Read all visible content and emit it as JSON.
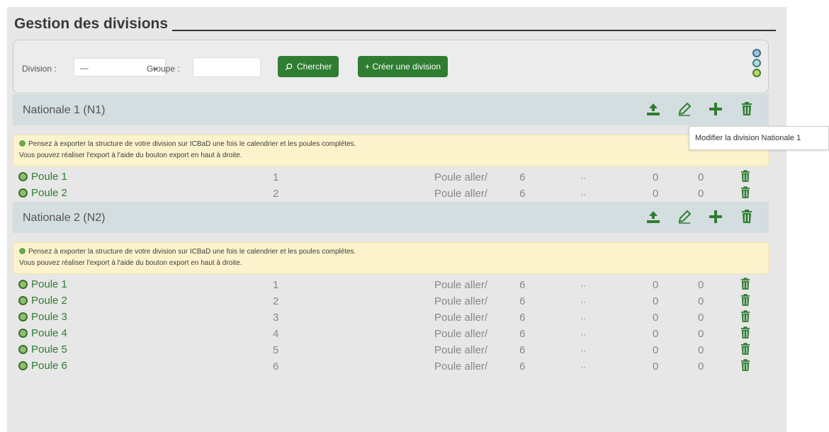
{
  "page": {
    "title": "Gestion des divisions"
  },
  "search": {
    "division_label": "Division :",
    "division_value": "---",
    "groupe_label": "Groupe :",
    "groupe_value": "",
    "search_button": "Chercher",
    "create_button": "+ Créer une division"
  },
  "colors": {
    "accent_green": "#2f7d32",
    "header_bg": "#d4dddf",
    "warning_bg": "#fcf3cd"
  },
  "tooltip": "Modifier la division Nationale 1",
  "warning": {
    "line1": "Pensez à exporter la structure de votre division sur ICBaD une fois le calendrier et les poules complétes.",
    "line2": "Vous pouvez réaliser l'export à l'aide du bouton export en haut à droite."
  },
  "divisions": [
    {
      "name": "Nationale 1 (N1)",
      "poules": [
        {
          "name": "Poule 1",
          "num": "1",
          "type": "Poule aller/",
          "count": "6",
          "dots": ",,",
          "z1": "0",
          "z2": "0"
        },
        {
          "name": "Poule 2",
          "num": "2",
          "type": "Poule aller/",
          "count": "6",
          "dots": ",,",
          "z1": "0",
          "z2": "0"
        }
      ]
    },
    {
      "name": "Nationale 2 (N2)",
      "poules": [
        {
          "name": "Poule 1",
          "num": "1",
          "type": "Poule aller/",
          "count": "6",
          "dots": ",,",
          "z1": "0",
          "z2": "0"
        },
        {
          "name": "Poule 2",
          "num": "2",
          "type": "Poule aller/",
          "count": "6",
          "dots": ",,",
          "z1": "0",
          "z2": "0"
        },
        {
          "name": "Poule 3",
          "num": "3",
          "type": "Poule aller/",
          "count": "6",
          "dots": ",,",
          "z1": "0",
          "z2": "0"
        },
        {
          "name": "Poule 4",
          "num": "4",
          "type": "Poule aller/",
          "count": "6",
          "dots": ",,",
          "z1": "0",
          "z2": "0"
        },
        {
          "name": "Poule 5",
          "num": "5",
          "type": "Poule aller/",
          "count": "6",
          "dots": ",,",
          "z1": "0",
          "z2": "0"
        },
        {
          "name": "Poule 6",
          "num": "6",
          "type": "Poule aller/",
          "count": "6",
          "dots": ",,",
          "z1": "0",
          "z2": "0"
        }
      ]
    }
  ]
}
